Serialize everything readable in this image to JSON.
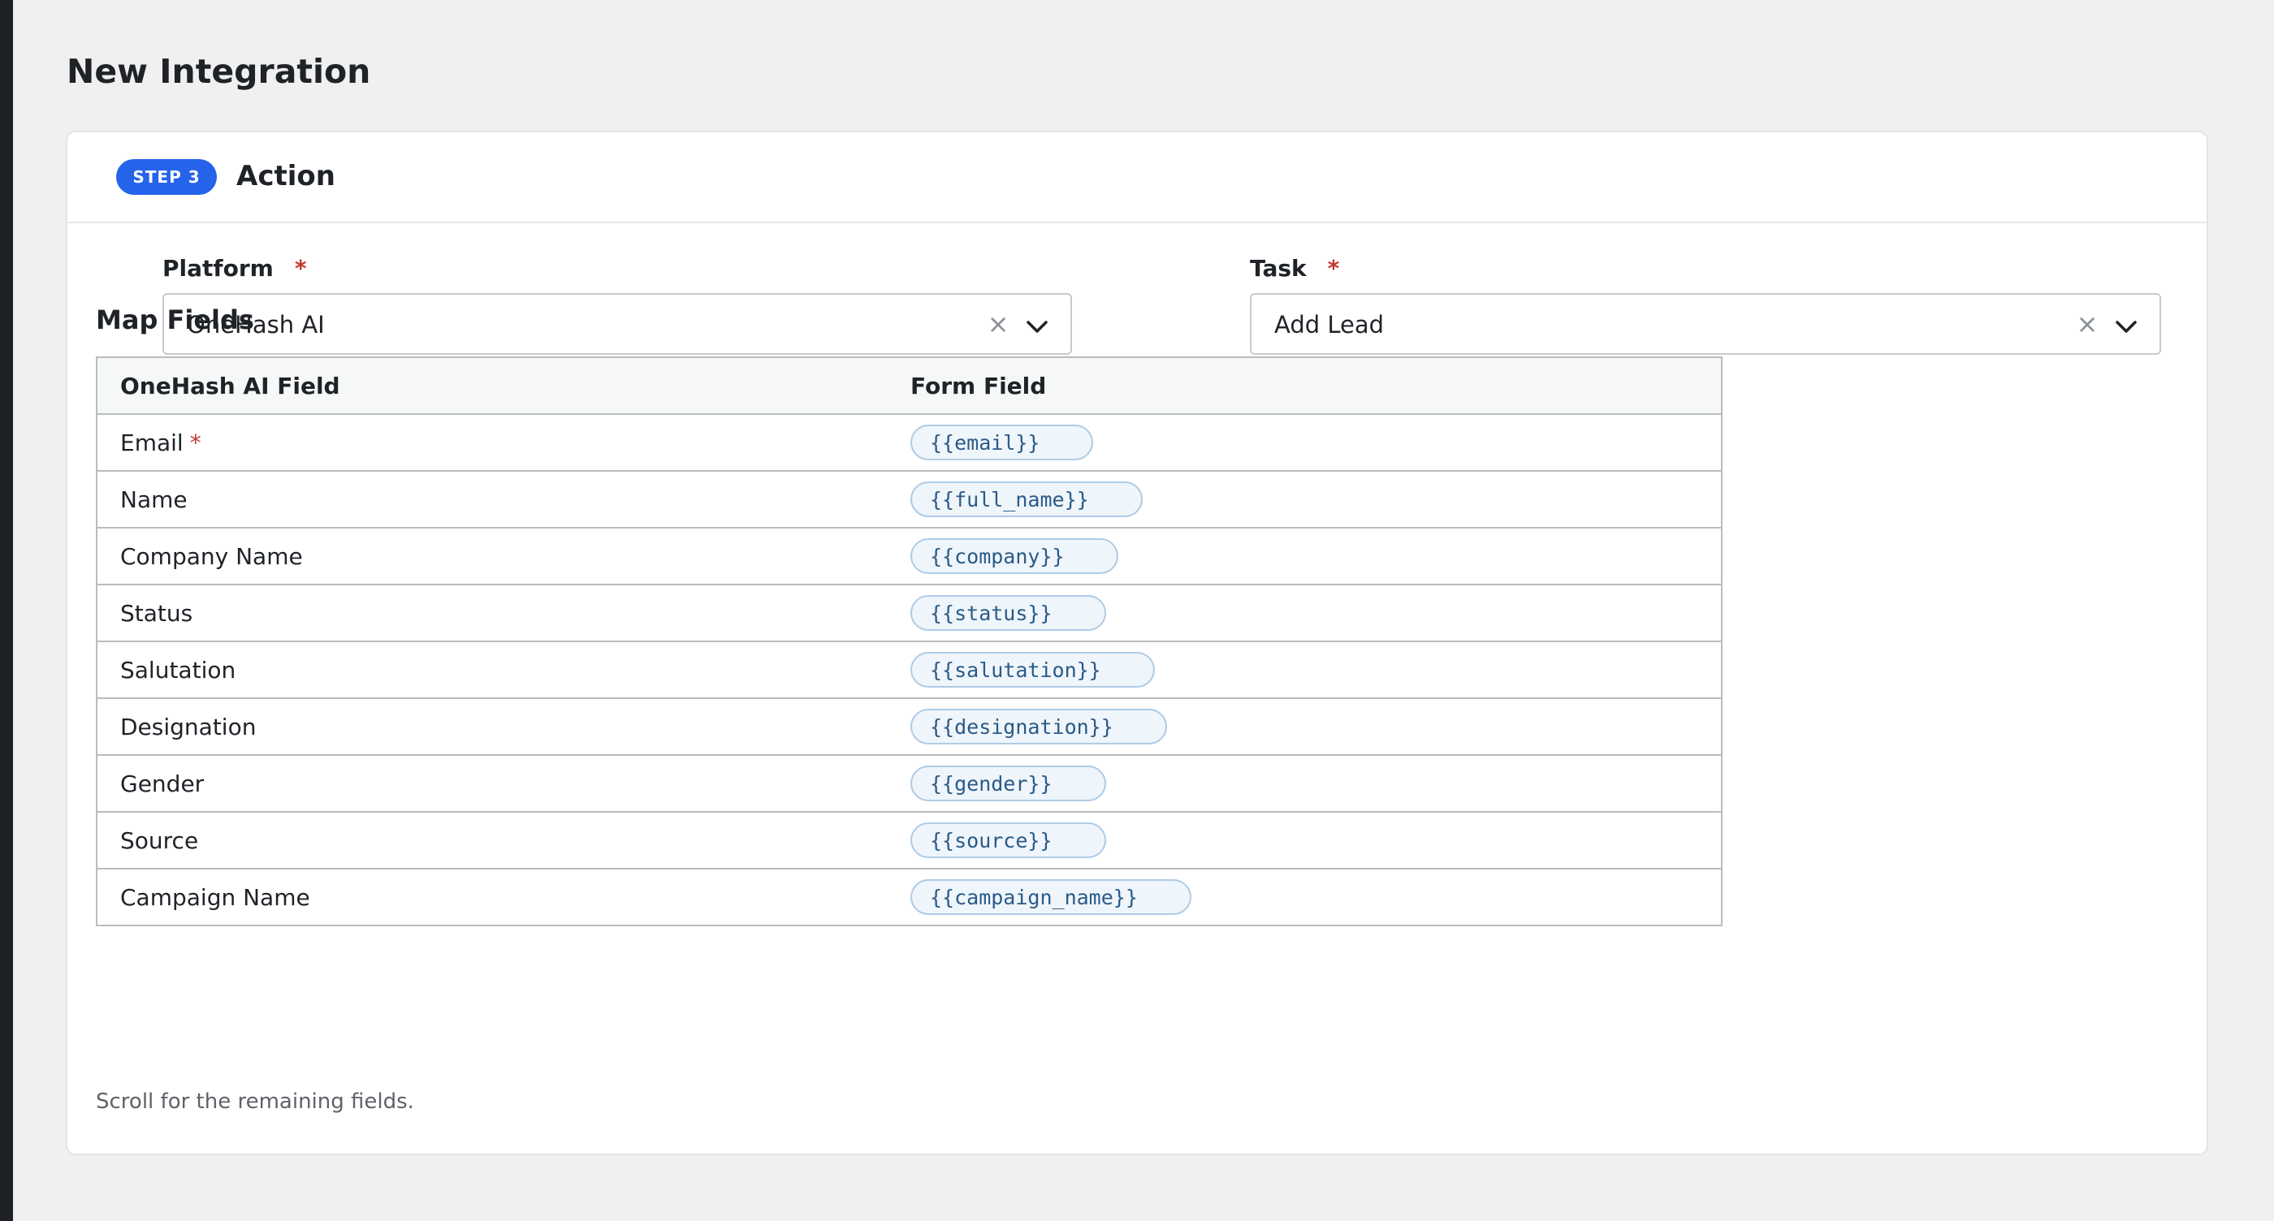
{
  "page": {
    "title": "New Integration"
  },
  "step": {
    "badge": "STEP 3",
    "title": "Action"
  },
  "platform": {
    "label": "Platform",
    "required_mark": "*",
    "value": "OneHash AI",
    "clear_glyph": "×",
    "clear_icon": "close-icon",
    "dropdown_icon": "chevron-down-icon"
  },
  "task": {
    "label": "Task",
    "required_mark": "*",
    "value": "Add Lead",
    "clear_glyph": "×",
    "clear_icon": "close-icon",
    "dropdown_icon": "chevron-down-icon"
  },
  "map_fields": {
    "title": "Map Fields",
    "columns": [
      "OneHash AI Field",
      "Form Field"
    ],
    "rows": [
      {
        "field": "Email",
        "required_mark": "*",
        "token": "{{email}}"
      },
      {
        "field": "Name",
        "token": "{{full_name}}"
      },
      {
        "field": "Company Name",
        "token": "{{company}}"
      },
      {
        "field": "Status",
        "token": "{{status}}"
      },
      {
        "field": "Salutation",
        "token": "{{salutation}}"
      },
      {
        "field": "Designation",
        "token": "{{designation}}"
      },
      {
        "field": "Gender",
        "token": "{{gender}}"
      },
      {
        "field": "Source",
        "token": "{{source}}"
      },
      {
        "field": "Campaign Name",
        "token": "{{campaign_name}}"
      }
    ],
    "footnote": "Scroll for the remaining fields."
  },
  "colors": {
    "accent": "#2563eb",
    "required": "#c0392b",
    "chip_bg": "#eef5fb",
    "chip_border": "#aecbe6",
    "chip_text": "#2b5a86",
    "page_bg": "#f0f0f0"
  }
}
